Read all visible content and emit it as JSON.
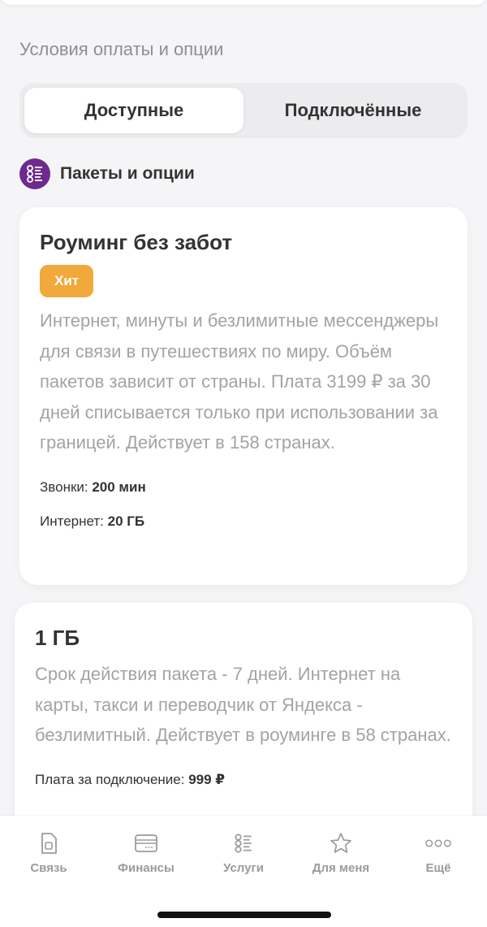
{
  "header": {
    "section_title": "Условия оплаты и опции"
  },
  "tabs": [
    {
      "label": "Доступные",
      "active": true
    },
    {
      "label": "Подключённые",
      "active": false
    }
  ],
  "category": {
    "label": "Пакеты и опции",
    "icon": "options-list-icon",
    "color": "#6e2a8f"
  },
  "cards": [
    {
      "title": "Роуминг без забот",
      "badge": "Хит",
      "badge_color": "#f0a93a",
      "description": "Интернет, минуты и безлимитные мессенджеры для связи в путешествиях по миру. Объём пакетов зависит от страны. Плата 3199 ₽ за 30 дней списывается только при использовании за границей. Действует в 158 странах.",
      "specs": [
        {
          "label": "Звонки: ",
          "value": "200 мин"
        },
        {
          "label": "Интернет: ",
          "value": "20 ГБ"
        }
      ]
    },
    {
      "title": "1 ГБ",
      "description": "Срок действия пакета - 7 дней. Интернет на карты, такси и переводчик от Яндекса - безлимитный. Действует в роуминге в 58 странах.",
      "specs": [
        {
          "label": "Плата за подключение: ",
          "value": "999 ₽"
        }
      ]
    }
  ],
  "bottom_nav": [
    {
      "label": "Связь",
      "icon": "sim-card-icon"
    },
    {
      "label": "Финансы",
      "icon": "wallet-icon"
    },
    {
      "label": "Услуги",
      "icon": "services-list-icon"
    },
    {
      "label": "Для меня",
      "icon": "star-icon"
    },
    {
      "label": "Ещё",
      "icon": "more-dots-icon"
    }
  ]
}
